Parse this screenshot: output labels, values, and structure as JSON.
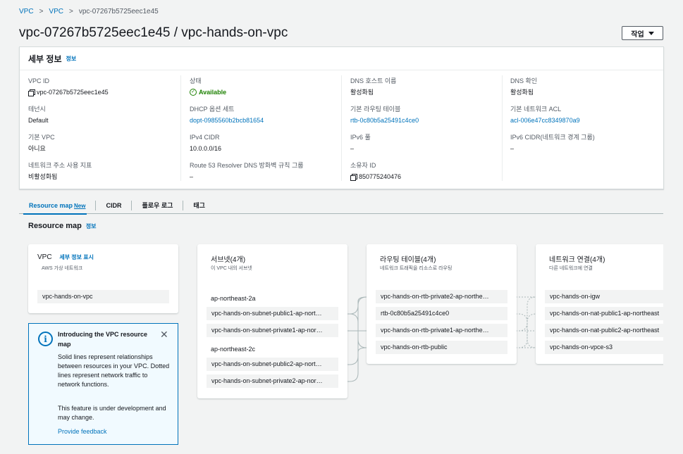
{
  "breadcrumb": [
    "VPC",
    "VPC",
    "vpc-07267b5725eec1e45"
  ],
  "page_title": "vpc-07267b5725eec1e45 / vpc-hands-on-vpc",
  "action_button": "작업",
  "details": {
    "header": "세부 정보",
    "info": "정보",
    "fields": {
      "vpc_id_label": "VPC ID",
      "vpc_id": "vpc-07267b5725eec1e45",
      "state_label": "상태",
      "state": "Available",
      "dns_host_label": "DNS 호스트 이름",
      "dns_host": "활성화됨",
      "dns_resolve_label": "DNS 확인",
      "dns_resolve": "활성화됨",
      "tenancy_label": "테넌시",
      "tenancy": "Default",
      "dhcp_label": "DHCP 옵션 세트",
      "dhcp": "dopt-0985560b2bcb81654",
      "main_rt_label": "기본 라우팅 테이블",
      "main_rt": "rtb-0c80b5a25491c4ce0",
      "main_acl_label": "기본 네트워크 ACL",
      "main_acl": "acl-006e47cc8349870a9",
      "default_vpc_label": "기본 VPC",
      "default_vpc": "아니요",
      "ipv4_label": "IPv4 CIDR",
      "ipv4": "10.0.0.0/16",
      "ipv6_pool_label": "IPv6 풀",
      "ipv6_pool": "–",
      "ipv6_cidr_label": "IPv6 CIDR(네트워크 경계 그룹)",
      "ipv6_cidr": "–",
      "net_metric_label": "네트워크 주소 사용 지표",
      "net_metric": "비활성화됨",
      "r53_label": "Route 53 Resolver DNS 방화벽 규칙 그룹",
      "r53": "–",
      "owner_label": "소유자 ID",
      "owner": "850775240476"
    }
  },
  "tabs": [
    {
      "label": "Resource map",
      "badge": "New"
    },
    {
      "label": "CIDR"
    },
    {
      "label": "플로우 로그"
    },
    {
      "label": "태그"
    }
  ],
  "resource_map": {
    "title": "Resource map",
    "info": "정보",
    "vpc_card": {
      "title": "VPC",
      "link": "세부 정보 표시",
      "subtitle": "AWS 가상 네트워크",
      "item": "vpc-hands-on-vpc"
    },
    "subnets_card": {
      "title": "서브넷(4개)",
      "subtitle": "이 VPC 내의 서브넷",
      "az1": "ap-northeast-2a",
      "az1_items": [
        "vpc-hands-on-subnet-public1-ap-nort…",
        "vpc-hands-on-subnet-private1-ap-nor…"
      ],
      "az2": "ap-northeast-2c",
      "az2_items": [
        "vpc-hands-on-subnet-public2-ap-nort…",
        "vpc-hands-on-subnet-private2-ap-nor…"
      ]
    },
    "rt_card": {
      "title": "라우팅 테이블(4개)",
      "subtitle": "네트워크 트래픽을 리소스로 라우팅",
      "items": [
        "vpc-hands-on-rtb-private2-ap-northe…",
        "rtb-0c80b5a25491c4ce0",
        "vpc-hands-on-rtb-private1-ap-northe…",
        "vpc-hands-on-rtb-public"
      ]
    },
    "net_card": {
      "title": "네트워크 연결(4개)",
      "subtitle": "다른 네트워크에 연결",
      "items": [
        "vpc-hands-on-igw",
        "vpc-hands-on-nat-public1-ap-northeast",
        "vpc-hands-on-nat-public2-ap-northeast",
        "vpc-hands-on-vpce-s3"
      ]
    }
  },
  "callout": {
    "title": "Introducing the VPC resource map",
    "body1": "Solid lines represent relationships between resources in your VPC. Dotted lines represent network traffic to network functions.",
    "body2": "This feature is under development and may change.",
    "feedback": "Provide feedback"
  }
}
